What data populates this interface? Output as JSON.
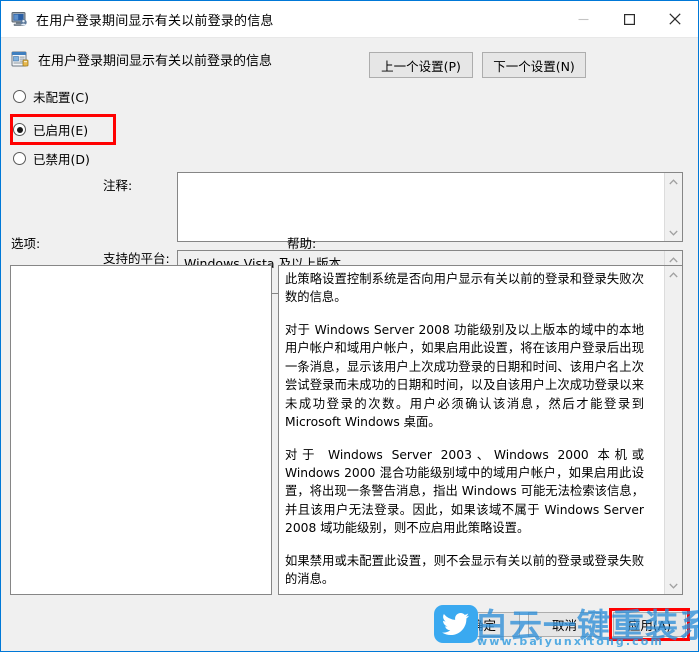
{
  "window": {
    "title": "在用户登录期间显示有关以前登录的信息",
    "icon": "computer-monitor-icon",
    "border_color": "#0078d7",
    "controls": {
      "minimize": "minimize-icon",
      "maximize": "maximize-icon",
      "close": "close-icon"
    }
  },
  "header": {
    "title": "在用户登录期间显示有关以前登录的信息",
    "icon": "group-policy-setting-icon",
    "prev_button": "上一个设置(P)",
    "next_button": "下一个设置(N)"
  },
  "state": {
    "options": [
      {
        "label": "未配置(C)",
        "checked": false,
        "highlighted": false
      },
      {
        "label": "已启用(E)",
        "checked": true,
        "highlighted": true
      },
      {
        "label": "已禁用(D)",
        "checked": false,
        "highlighted": false
      }
    ],
    "highlight_color": "#ff0000"
  },
  "fields": {
    "comment_label": "注释:",
    "comment_value": "",
    "platform_label": "支持的平台:",
    "platform_value": "Windows Vista 及以上版本"
  },
  "panes": {
    "options_label": "选项:",
    "options_value": "",
    "help_label": "帮助:",
    "help_paragraphs": [
      "此策略设置控制系统是否向用户显示有关以前的登录和登录失败次数的信息。",
      "对于 Windows Server 2008 功能级别及以上版本的域中的本地用户帐户和域用户帐户，如果启用此设置，将在该用户登录后出现一条消息，显示该用户上次成功登录的日期和时间、该用户名上次尝试登录而未成功的日期和时间，以及自该用户上次成功登录以来未成功登录的次数。用户必须确认该消息，然后才能登录到 Microsoft Windows 桌面。",
      "对于 Windows Server 2003、Windows 2000 本机或 Windows 2000 混合功能级别域中的域用户帐户，如果启用此设置，将出现一条警告消息，指出 Windows 可能无法检索该信息，并且该用户无法登录。因此，如果该域不属于 Windows Server 2008 域功能级别，则不应启用此策略设置。",
      "如果禁用或未配置此设置，则不会显示有关以前的登录或登录失败的消息。"
    ]
  },
  "footer": {
    "ok_label": "确定",
    "cancel_label": "取消",
    "apply_label": "应用(A)",
    "apply_highlighted": true
  },
  "watermark": {
    "brand": "白云一键重装系统",
    "url": "www.baiyunxitong.com",
    "icon": "twitter-bird-icon",
    "color": "#2f8fd8"
  }
}
